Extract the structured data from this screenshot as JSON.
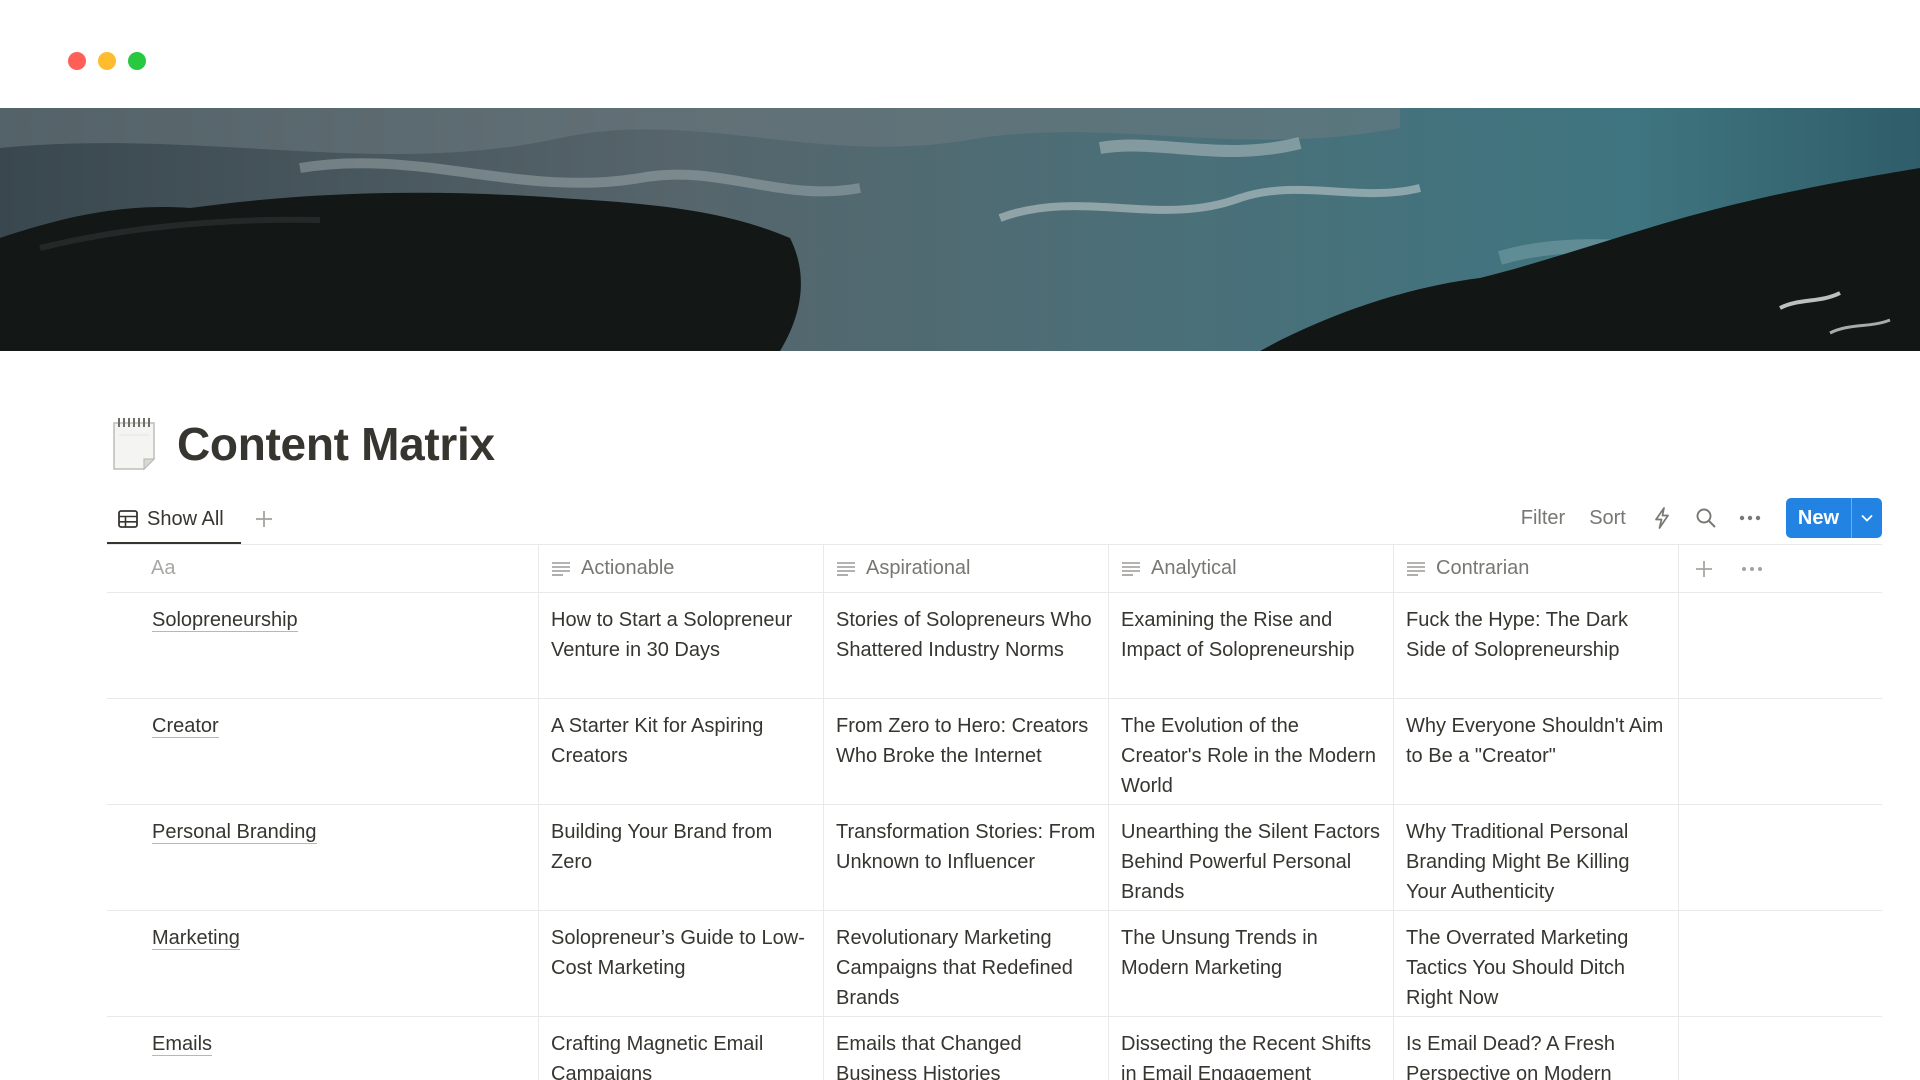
{
  "page": {
    "title": "Content Matrix",
    "icon": "spiral-notepad-icon"
  },
  "view": {
    "tab_label": "Show All",
    "tab_icon": "table-icon",
    "add_view_icon": "plus-icon"
  },
  "toolbar": {
    "filter": "Filter",
    "sort": "Sort",
    "automation_icon": "lightning-icon",
    "search_icon": "search-icon",
    "more_icon": "ellipsis-icon",
    "new_label": "New",
    "new_caret_icon": "chevron-down-icon"
  },
  "colors": {
    "accent": "#2383e2",
    "text": "#37352f",
    "muted": "#787774",
    "border": "#e9e9e7"
  },
  "table": {
    "name_header": "Aa",
    "columns": [
      "Actionable",
      "Aspirational",
      "Analytical",
      "Contrarian"
    ],
    "rows": [
      {
        "name": "Solopreneurship",
        "cells": [
          "How to Start a Solopreneur Venture in 30 Days",
          "Stories of Solopreneurs Who Shattered Industry Norms",
          "Examining the Rise and Impact of Solopreneurship",
          "Fuck the Hype: The Dark Side of Solopreneurship"
        ]
      },
      {
        "name": "Creator",
        "cells": [
          "A Starter Kit for Aspiring Creators",
          "From Zero to Hero: Creators Who Broke the Internet",
          "The Evolution of the Creator's Role in the Modern World",
          "Why Everyone Shouldn't Aim to Be a \"Creator\""
        ]
      },
      {
        "name": "Personal Branding",
        "cells": [
          "Building Your Brand from Zero",
          "Transformation Stories: From Unknown to Influencer",
          "Unearthing the Silent Factors Behind Powerful Personal Brands",
          "Why Traditional Personal Branding Might Be Killing Your Authenticity"
        ]
      },
      {
        "name": "Marketing",
        "cells": [
          "Solopreneur’s Guide to Low-Cost Marketing",
          "Revolutionary Marketing Campaigns that Redefined Brands",
          "The Unsung Trends in Modern Marketing",
          "The Overrated Marketing Tactics You Should Ditch Right Now"
        ]
      },
      {
        "name": "Emails",
        "cells": [
          "Crafting Magnetic Email Campaigns",
          "Emails that Changed Business Histories",
          "Dissecting the Recent Shifts in Email Engagement",
          "Is Email Dead? A Fresh Perspective on Modern"
        ]
      }
    ]
  }
}
